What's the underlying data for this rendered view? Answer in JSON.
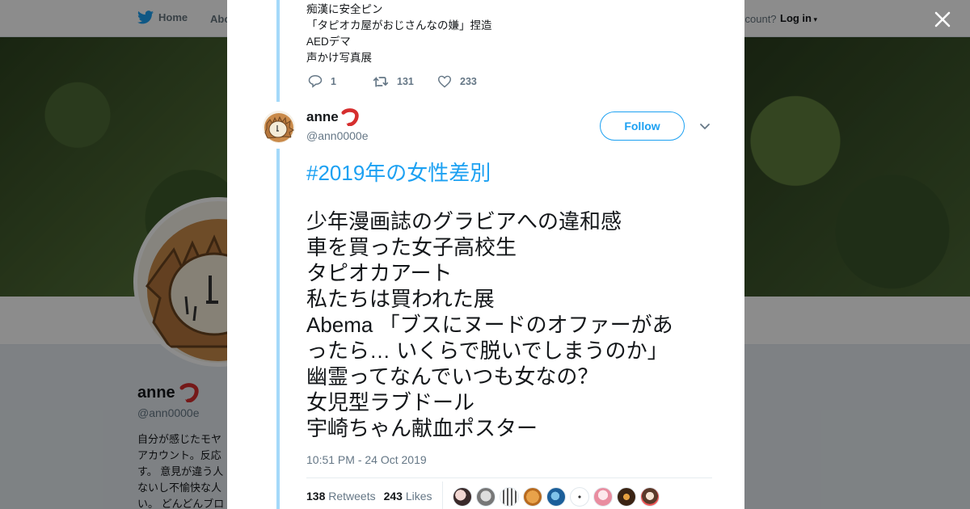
{
  "topbar": {
    "home_label": "Home",
    "about_label": "Abo",
    "account_text": "ccount?",
    "login_label": "Log in"
  },
  "profile": {
    "name": "anne",
    "handle": "@ann0000e",
    "bio_lines": [
      "自分が感じたモヤ",
      "アカウント。反応",
      "す。 意見が違う人",
      "ないし不愉快な人",
      "い。 どんどんブロ"
    ]
  },
  "prev_tweet": {
    "lines": [
      "痴漢に安全ピン",
      "「タピオカ屋がおじさんなの嫌」捏造",
      "AEDデマ",
      "声かけ写真展"
    ],
    "replies": "1",
    "retweets": "131",
    "likes": "233"
  },
  "tweet": {
    "author_name": "anne",
    "author_handle": "@ann0000e",
    "follow_label": "Follow",
    "hashtag": "#2019年の女性差別",
    "lines": [
      "少年漫画誌のグラビアへの違和感",
      "車を買った女子高校生",
      "タピオカアート",
      "私たちは買われた展",
      "Abema 「ブスにヌードのオファーがあ",
      "ったら… いくらで脱いでしまうのか」",
      "幽霊ってなんでいつも女なの？",
      "女児型ラブドール",
      "宇崎ちゃん献血ポスター"
    ],
    "timestamp": "10:51 PM - 24 Oct 2019",
    "retweet_count": "138",
    "retweet_label": "Retweets",
    "like_count": "243",
    "like_label": "Likes"
  },
  "colors": {
    "accent": "#1da1f2",
    "thread_line": "#a4d9f9",
    "muted": "#657786",
    "shrimp": "#d62e2e"
  },
  "icons": [
    "twitter-bird-icon",
    "close-icon",
    "reply-icon",
    "retweet-icon",
    "like-icon",
    "chevron-down-icon",
    "shrimp-emoji-icon"
  ]
}
